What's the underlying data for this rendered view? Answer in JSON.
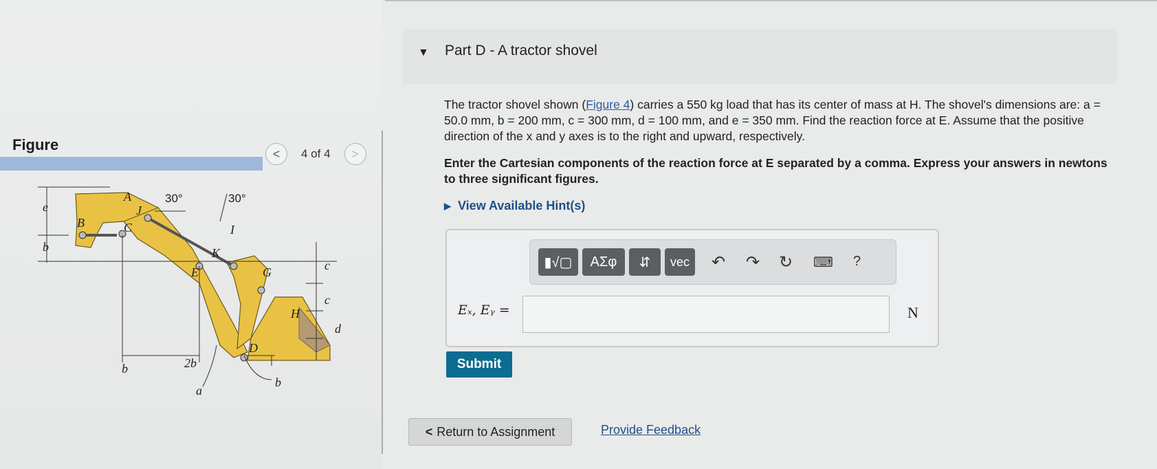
{
  "figure": {
    "title": "Figure",
    "pager": {
      "prev": "<",
      "text": "4 of 4",
      "next": ">"
    },
    "diagram_labels": {
      "e": "e",
      "b": "b",
      "B": "B",
      "A": "A",
      "C": "C",
      "J": "J",
      "angle1": "30°",
      "angle2": "30°",
      "I": "I",
      "E": "E",
      "K": "K",
      "G": "G",
      "H": "H",
      "c1": "c",
      "c2": "c",
      "d": "d",
      "D": "D",
      "b_bottom1": "b",
      "two_b": "2b",
      "b_bottom2": "b",
      "a": "a"
    }
  },
  "part": {
    "caret": "▼",
    "title": "Part D - A tractor shovel"
  },
  "problem": {
    "pre": "The tractor shovel shown (",
    "link": "Figure 4",
    "post": ") carries a 550 kg load that has its center of mass at H. The shovel's dimensions are: a = 50.0 mm, b = 200 mm, c = 300 mm, d = 100 mm, and e = 350 mm. Find the reaction force at E. Assume that the positive direction of the x and y axes is to the right and upward, respectively."
  },
  "instructions": "Enter the Cartesian components of the reaction force at E separated by a comma. Express your answers in newtons to three significant figures.",
  "hints": {
    "arrow": "▶",
    "label": "View Available Hint(s)"
  },
  "toolbar": {
    "templates": "▮√▢",
    "greek": "ΑΣφ",
    "arrows": "⇵",
    "vec": "vec",
    "undo": "↶",
    "redo": "↷",
    "reset": "↻",
    "keyboard": "⌨",
    "help": "?"
  },
  "answer": {
    "label": "Eₓ, Eᵧ =",
    "value": "",
    "unit": "N"
  },
  "submit_label": "Submit",
  "return_label": "Return to Assignment",
  "return_icon": "<",
  "feedback_label": "Provide Feedback"
}
